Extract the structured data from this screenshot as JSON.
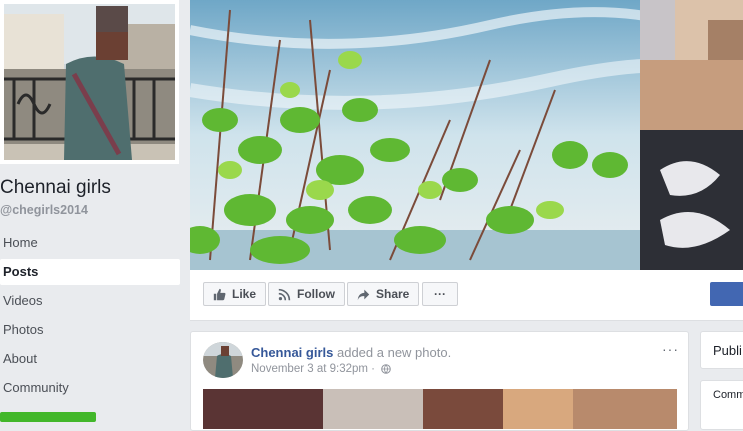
{
  "page": {
    "name": "Chennai girls",
    "handle": "@chegirls2014"
  },
  "nav": {
    "items": [
      {
        "label": "Home",
        "active": false
      },
      {
        "label": "Posts",
        "active": true
      },
      {
        "label": "Videos",
        "active": false
      },
      {
        "label": "Photos",
        "active": false
      },
      {
        "label": "About",
        "active": false
      },
      {
        "label": "Community",
        "active": false
      }
    ]
  },
  "actions": {
    "like": "Like",
    "follow": "Follow",
    "share": "Share",
    "more": "···"
  },
  "post": {
    "author": "Chennai girls",
    "action": "added a new photo.",
    "time": "November 3 at 9:32pm ·",
    "menu": "···"
  },
  "sidebar": {
    "box1_label": "Publi",
    "box2_label": "Comm"
  },
  "colors": {
    "background": "#e9ebee",
    "link": "#365899",
    "brand_blue": "#4267b2",
    "green": "#42b72a"
  }
}
